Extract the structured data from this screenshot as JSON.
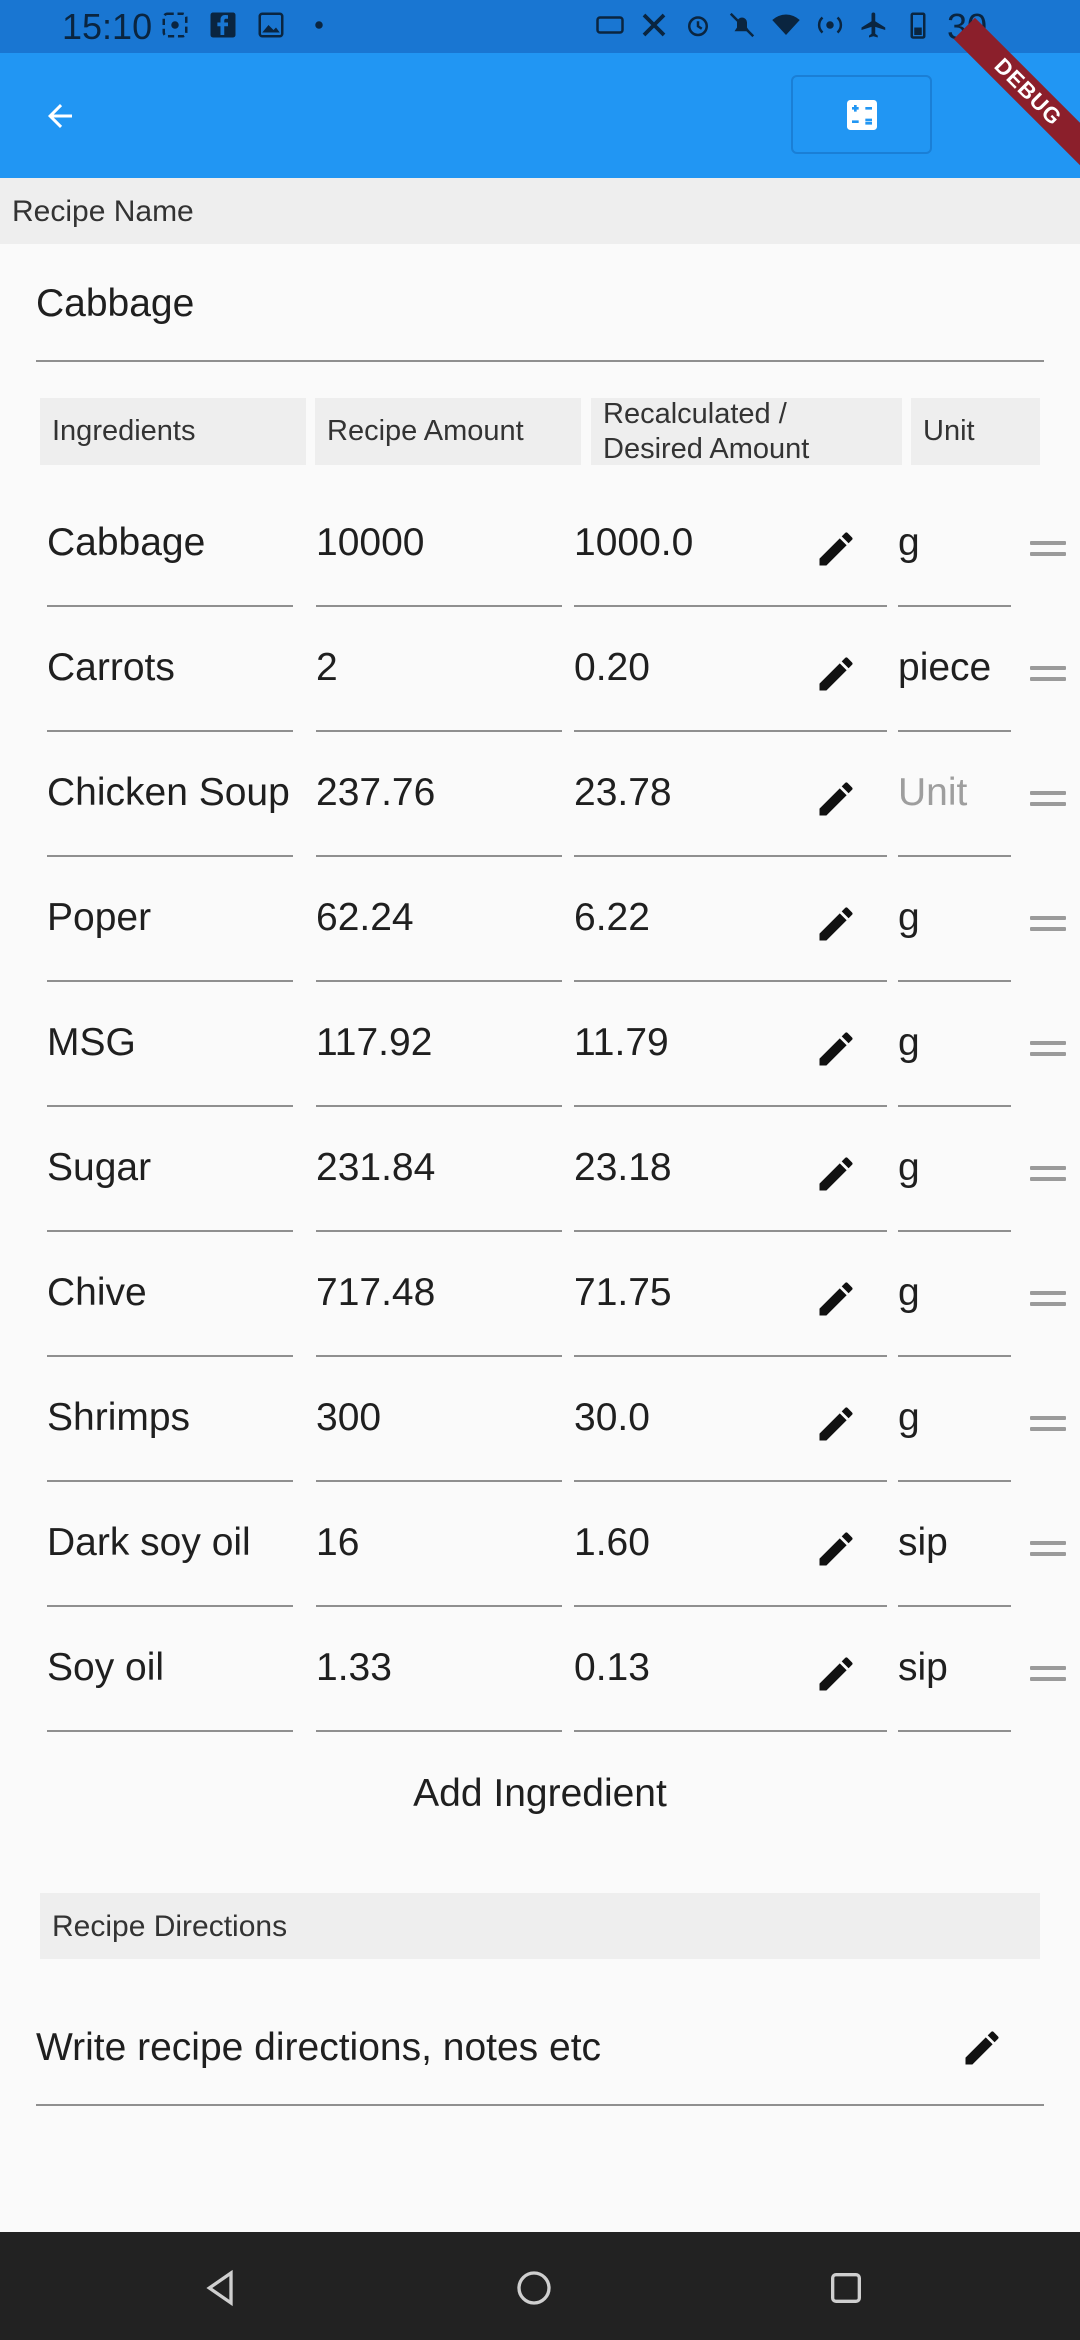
{
  "status_bar": {
    "time": "15:10",
    "battery": "30"
  },
  "app_bar": {
    "debug_label": "DEBUG"
  },
  "recipe_name": {
    "header": "Recipe Name",
    "value": "Cabbage"
  },
  "columns": {
    "ingredients": "Ingredients",
    "recipe_amount": "Recipe Amount",
    "recalc_line1": "Recalculated /",
    "recalc_line2": "Desired Amount",
    "unit": "Unit"
  },
  "ingredients": [
    {
      "name": "Cabbage",
      "amount": "10000",
      "recalc": "1000.0",
      "unit": "g"
    },
    {
      "name": "Carrots",
      "amount": "2",
      "recalc": "0.20",
      "unit": "piece"
    },
    {
      "name": "Chicken Soup",
      "amount": "237.76",
      "recalc": "23.78",
      "unit": "Unit"
    },
    {
      "name": "Poper",
      "amount": "62.24",
      "recalc": "6.22",
      "unit": "g"
    },
    {
      "name": "MSG",
      "amount": "117.92",
      "recalc": "11.79",
      "unit": "g"
    },
    {
      "name": "Sugar",
      "amount": "231.84",
      "recalc": "23.18",
      "unit": "g"
    },
    {
      "name": "Chive",
      "amount": "717.48",
      "recalc": "71.75",
      "unit": "g"
    },
    {
      "name": "Shrimps",
      "amount": "300",
      "recalc": "30.0",
      "unit": "g"
    },
    {
      "name": "Dark soy oil",
      "amount": "16",
      "recalc": "1.60",
      "unit": "sip"
    },
    {
      "name": "Soy oil",
      "amount": "1.33",
      "recalc": "0.13",
      "unit": "sip"
    }
  ],
  "add_ingredient_label": "Add Ingredient",
  "directions": {
    "header": "Recipe Directions",
    "placeholder": "Write recipe directions, notes etc"
  },
  "icons": {
    "back": "arrow-back-icon",
    "calculator": "calculator-icon",
    "edit": "pencil-icon",
    "drag": "drag-handle-icon",
    "nav_back": "triangle-back-icon",
    "nav_home": "circle-home-icon",
    "nav_recent": "square-recent-icon"
  },
  "colors": {
    "app_bar": "#2196f3",
    "status_bar": "#1976d2",
    "header_bg": "#eeeeee",
    "nav_bar": "#222222"
  }
}
